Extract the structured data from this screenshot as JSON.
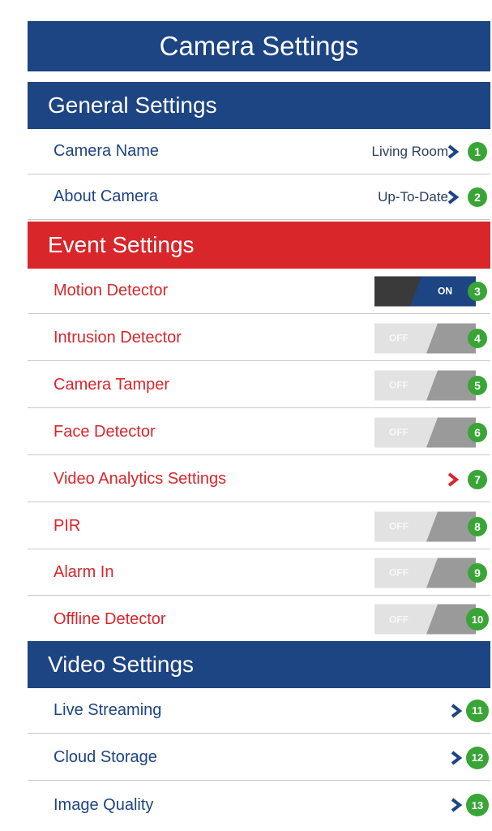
{
  "header": {
    "title": "Camera Settings"
  },
  "general": {
    "header": "General Settings",
    "items": [
      {
        "label": "Camera Name",
        "value": "Living Room",
        "badge": "1"
      },
      {
        "label": "About Camera",
        "value": "Up-To-Date",
        "badge": "2"
      }
    ]
  },
  "event": {
    "header": "Event Settings",
    "items": [
      {
        "label": "Motion Detector",
        "toggle": "ON",
        "badge": "3"
      },
      {
        "label": "Intrusion Detector",
        "toggle": "OFF",
        "badge": "4"
      },
      {
        "label": "Camera Tamper",
        "toggle": "OFF",
        "badge": "5"
      },
      {
        "label": "Face Detector",
        "toggle": "OFF",
        "badge": "6"
      },
      {
        "label": "Video Analytics Settings",
        "badge": "7"
      },
      {
        "label": "PIR",
        "toggle": "OFF",
        "badge": "8"
      },
      {
        "label": "Alarm In",
        "toggle": "OFF",
        "badge": "9"
      },
      {
        "label": "Offline Detector",
        "toggle": "OFF",
        "badge": "10"
      }
    ]
  },
  "video": {
    "header": "Video Settings",
    "items": [
      {
        "label": "Live Streaming",
        "badge": "11"
      },
      {
        "label": "Cloud Storage",
        "badge": "12"
      },
      {
        "label": "Image Quality",
        "badge": "13"
      }
    ]
  },
  "icons": {
    "chevron": "chevron-right-icon",
    "toggle": "toggle-switch"
  },
  "colors": {
    "blue": "#1d4483",
    "red": "#d8262b",
    "badge_green": "#3aa537",
    "toggle_off_light": "#e2e2e2",
    "toggle_off_dark": "#9a9a9a",
    "toggle_on_dark": "#3a3a3a"
  }
}
